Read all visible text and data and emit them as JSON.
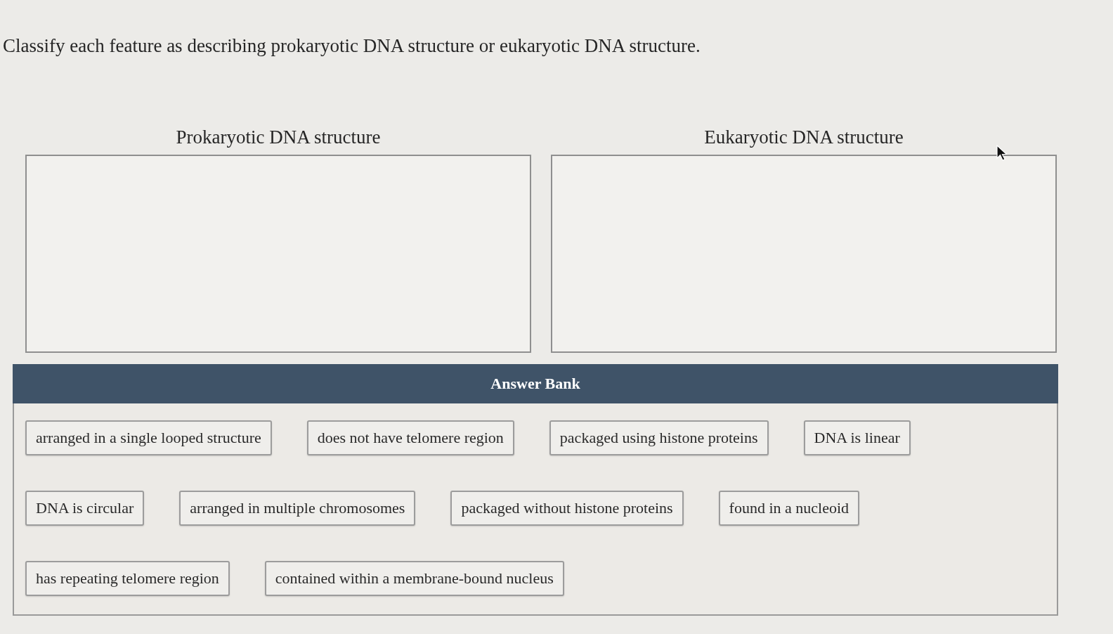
{
  "question": "Classify each feature as describing prokaryotic DNA structure or eukaryotic DNA structure.",
  "bins": [
    {
      "label": "Prokaryotic DNA structure"
    },
    {
      "label": "Eukaryotic DNA structure"
    }
  ],
  "answer_bank": {
    "title": "Answer Bank",
    "items": [
      "arranged in a single looped structure",
      "does not have telomere region",
      "packaged using histone proteins",
      "DNA is linear",
      "DNA is circular",
      "arranged in multiple chromosomes",
      "packaged without histone proteins",
      "found in a nucleoid",
      "has repeating telomere region",
      "contained within a membrane-bound nucleus"
    ]
  }
}
